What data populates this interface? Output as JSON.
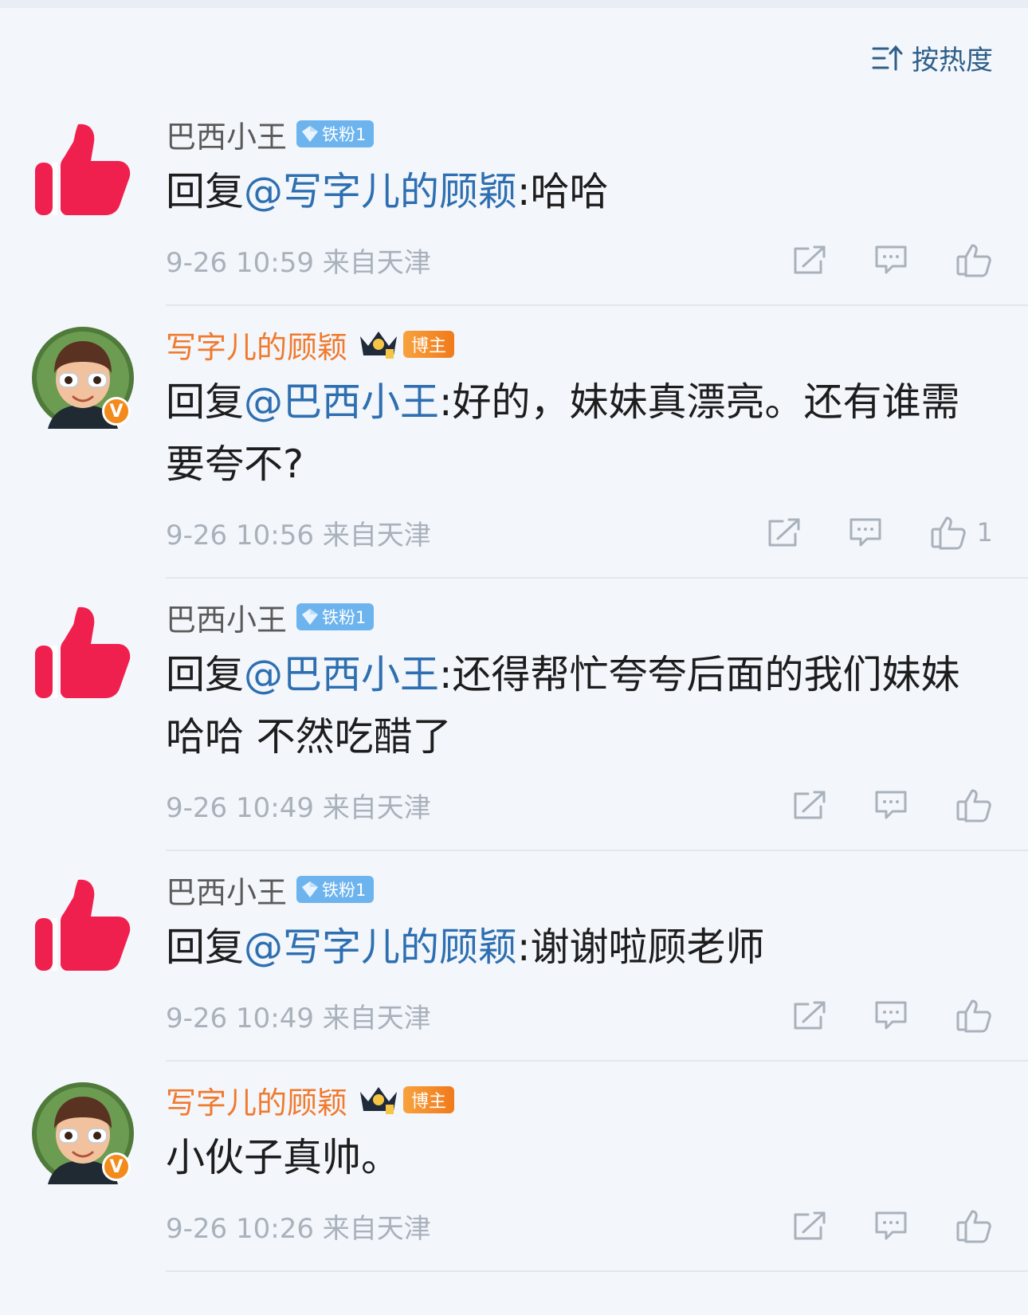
{
  "sort": {
    "label": "按热度",
    "icon": "sort-hot-icon"
  },
  "comments": [
    {
      "author": "巴西小王",
      "author_type": "fan",
      "badge": "铁粉1",
      "avatar_icon": "thumbs-up-avatar-icon",
      "reply_prefix": "回复",
      "mention": "@写字儿的顾颖",
      "text": ":哈哈",
      "time": "9-26 10:59",
      "location": "来自天津",
      "likes": ""
    },
    {
      "author": "写字儿的顾颖",
      "author_type": "blogger",
      "badge": "博主",
      "avatar_icon": "cartoon-boy-avatar-icon",
      "reply_prefix": "回复",
      "mention": "@巴西小王",
      "text": ":好的，妹妹真漂亮。还有谁需要夸不?",
      "time": "9-26 10:56",
      "location": "来自天津",
      "likes": "1"
    },
    {
      "author": "巴西小王",
      "author_type": "fan",
      "badge": "铁粉1",
      "avatar_icon": "thumbs-up-avatar-icon",
      "reply_prefix": "回复",
      "mention": "@巴西小王",
      "text": ":还得帮忙夸夸后面的我们妹妹 哈哈  不然吃醋了",
      "time": "9-26 10:49",
      "location": "来自天津",
      "likes": ""
    },
    {
      "author": "巴西小王",
      "author_type": "fan",
      "badge": "铁粉1",
      "avatar_icon": "thumbs-up-avatar-icon",
      "reply_prefix": "回复",
      "mention": "@写字儿的顾颖",
      "text": ":谢谢啦顾老师",
      "time": "9-26 10:49",
      "location": "来自天津",
      "likes": ""
    },
    {
      "author": "写字儿的顾颖",
      "author_type": "blogger",
      "badge": "博主",
      "avatar_icon": "cartoon-boy-avatar-icon",
      "reply_prefix": "",
      "mention": "",
      "text": "小伙子真帅。",
      "time": "9-26 10:26",
      "location": "来自天津",
      "likes": ""
    }
  ],
  "colors": {
    "mention": "#2d6fb0",
    "blogger_name": "#f07a2e",
    "fan_badge": "#6db4ee",
    "thumb_avatar": "#f0204e",
    "verified": "#f38a1c"
  }
}
